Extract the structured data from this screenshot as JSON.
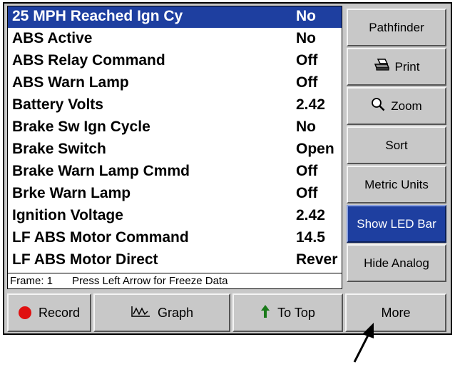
{
  "data_list": {
    "rows": [
      {
        "name": "25 MPH Reached Ign Cy",
        "value": "No",
        "selected": true
      },
      {
        "name": "ABS Active",
        "value": "No"
      },
      {
        "name": "ABS Relay Command",
        "value": "Off"
      },
      {
        "name": "ABS Warn Lamp",
        "value": "Off"
      },
      {
        "name": "Battery Volts",
        "value": "2.42"
      },
      {
        "name": "Brake Sw Ign Cycle",
        "value": "No"
      },
      {
        "name": "Brake Switch",
        "value": "Open"
      },
      {
        "name": "Brake Warn Lamp Cmmd",
        "value": "Off"
      },
      {
        "name": "Brke Warn Lamp",
        "value": "Off"
      },
      {
        "name": "Ignition Voltage",
        "value": "2.42"
      },
      {
        "name": "LF ABS Motor Command",
        "value": "14.5"
      },
      {
        "name": "LF ABS Motor Direct",
        "value": "Rever"
      }
    ]
  },
  "status_bar": {
    "frame": "Frame: 1",
    "hint": "Press Left Arrow for Freeze Data"
  },
  "side_buttons": {
    "pathfinder": "Pathfinder",
    "print": "Print",
    "zoom": "Zoom",
    "sort": "Sort",
    "metric_units": "Metric Units",
    "show_led_bar": "Show LED Bar",
    "hide_analog": "Hide Analog"
  },
  "bottom_buttons": {
    "record": "Record",
    "graph": "Graph",
    "to_top": "To Top",
    "more": "More"
  },
  "colors": {
    "selection": "#1e3fa0",
    "record_dot": "#e01010",
    "to_top_arrow": "#1a7a1a"
  },
  "icons": [
    "printer-icon",
    "magnifier-icon",
    "record-dot-icon",
    "graph-icon",
    "up-arrow-icon"
  ]
}
